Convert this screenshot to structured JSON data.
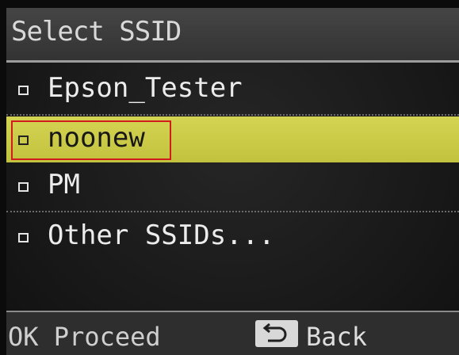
{
  "header": {
    "title": "Select SSID"
  },
  "ssid_list": {
    "items": [
      {
        "label": "Epson_Tester",
        "selected": false
      },
      {
        "label": "noonew",
        "selected": true
      },
      {
        "label": "PM",
        "selected": false
      },
      {
        "label": "Other SSIDs...",
        "selected": false
      }
    ]
  },
  "footer": {
    "ok_label": "OK Proceed",
    "back_label": "Back"
  },
  "colors": {
    "highlight": "#cdcd4a",
    "annotation_box": "#d01c1c"
  },
  "icons": {
    "bullet": "square-bullet-icon",
    "back": "back-arrow-icon"
  }
}
